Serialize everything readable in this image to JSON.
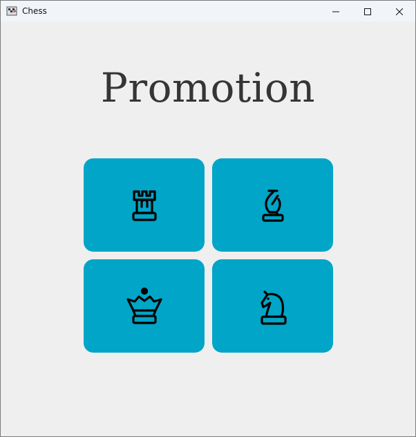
{
  "window": {
    "title": "Chess",
    "app_icon": "chess-app-icon",
    "controls": [
      {
        "name": "minimize",
        "icon": "minimize-icon"
      },
      {
        "name": "maximize",
        "icon": "maximize-icon"
      },
      {
        "name": "close",
        "icon": "close-icon"
      }
    ]
  },
  "main": {
    "heading": "Promotion",
    "options": [
      {
        "piece": "rook",
        "icon": "rook-icon"
      },
      {
        "piece": "bishop",
        "icon": "bishop-icon"
      },
      {
        "piece": "queen",
        "icon": "queen-icon"
      },
      {
        "piece": "knight",
        "icon": "knight-icon"
      }
    ]
  },
  "colors": {
    "button_bg": "#00a5c7",
    "background": "#efefef",
    "heading": "#353535",
    "icon_stroke": "#000000"
  }
}
